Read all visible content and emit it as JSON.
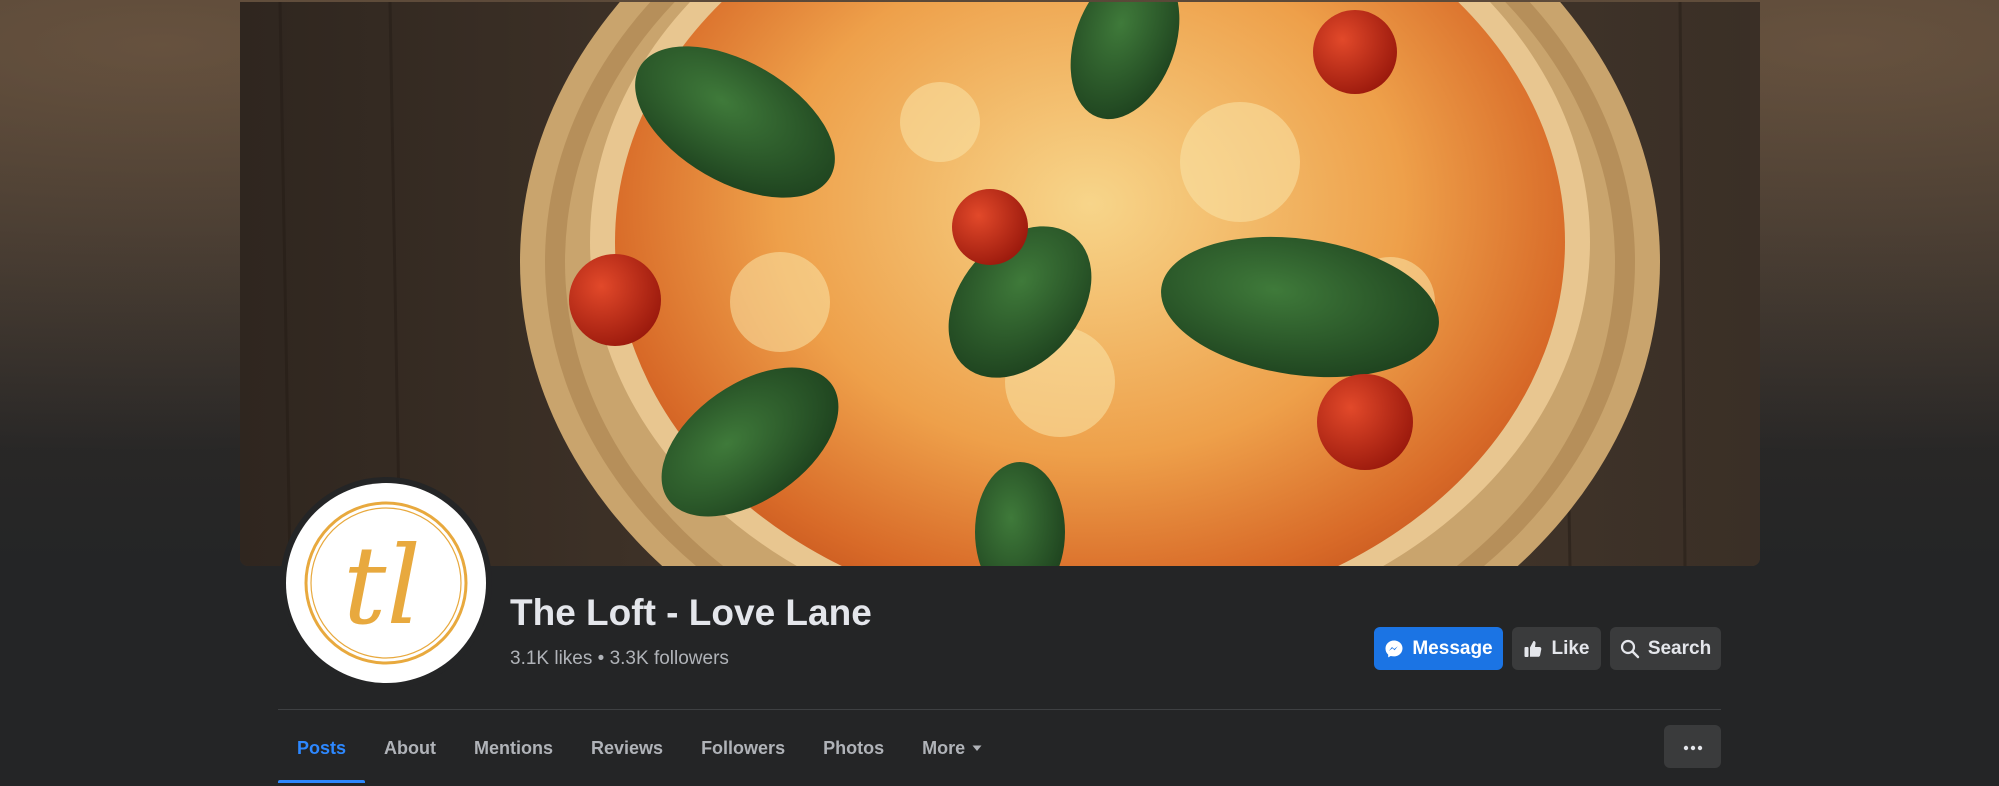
{
  "page": {
    "name": "The Loft - Love Lane",
    "stats": "3.1K likes • 3.3K followers",
    "logo_text": "tl"
  },
  "actions": {
    "message": "Message",
    "like": "Like",
    "search": "Search"
  },
  "tabs": [
    {
      "label": "Posts",
      "active": true
    },
    {
      "label": "About"
    },
    {
      "label": "Mentions"
    },
    {
      "label": "Reviews"
    },
    {
      "label": "Followers"
    },
    {
      "label": "Photos"
    },
    {
      "label": "More"
    }
  ],
  "icons": {
    "messenger": "messenger-icon",
    "like": "thumbs-up-icon",
    "search": "search-icon",
    "more": "caret-down-icon",
    "overflow": "more-dots-icon"
  },
  "colors": {
    "accent": "#2d88ff",
    "primary_button": "#1b74e4",
    "logo": "#e8a93e",
    "background": "#242526"
  }
}
